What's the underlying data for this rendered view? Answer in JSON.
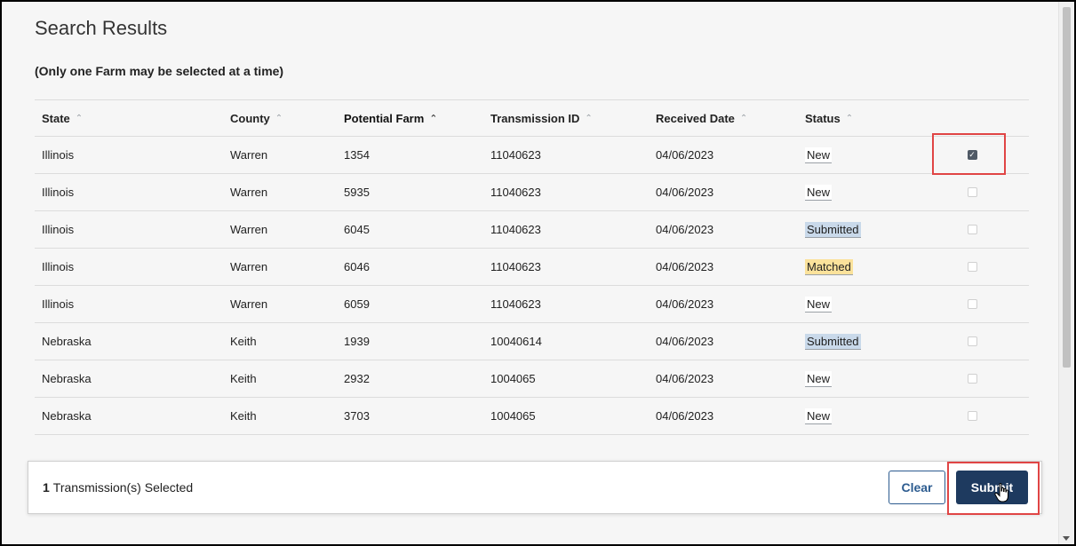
{
  "page": {
    "title": "Search Results",
    "note": "(Only one Farm may be selected at a time)"
  },
  "table": {
    "headers": {
      "state": "State",
      "county": "County",
      "potential_farm": "Potential Farm",
      "transmission_id": "Transmission ID",
      "received_date": "Received Date",
      "status": "Status"
    },
    "sort_icons": {
      "inactive": "⌃",
      "active": "⌃"
    },
    "rows": [
      {
        "state": "Illinois",
        "county": "Warren",
        "farm": "1354",
        "transmission_id": "11040623",
        "date": "04/06/2023",
        "status": "New",
        "checked": true
      },
      {
        "state": "Illinois",
        "county": "Warren",
        "farm": "5935",
        "transmission_id": "11040623",
        "date": "04/06/2023",
        "status": "New",
        "checked": false
      },
      {
        "state": "Illinois",
        "county": "Warren",
        "farm": "6045",
        "transmission_id": "11040623",
        "date": "04/06/2023",
        "status": "Submitted",
        "checked": false
      },
      {
        "state": "Illinois",
        "county": "Warren",
        "farm": "6046",
        "transmission_id": "11040623",
        "date": "04/06/2023",
        "status": "Matched",
        "checked": false
      },
      {
        "state": "Illinois",
        "county": "Warren",
        "farm": "6059",
        "transmission_id": "11040623",
        "date": "04/06/2023",
        "status": "New",
        "checked": false
      },
      {
        "state": "Nebraska",
        "county": "Keith",
        "farm": "1939",
        "transmission_id": "10040614",
        "date": "04/06/2023",
        "status": "Submitted",
        "checked": false
      },
      {
        "state": "Nebraska",
        "county": "Keith",
        "farm": "2932",
        "transmission_id": "1004065",
        "date": "04/06/2023",
        "status": "New",
        "checked": false
      },
      {
        "state": "Nebraska",
        "county": "Keith",
        "farm": "3703",
        "transmission_id": "1004065",
        "date": "04/06/2023",
        "status": "New",
        "checked": false
      }
    ]
  },
  "footer": {
    "selected_count": "1",
    "selected_label": "Transmission(s) Selected",
    "clear_label": "Clear",
    "submit_label": "Submit"
  },
  "colors": {
    "status_submitted": "#c9d9ea",
    "status_matched": "#fbe29b",
    "submit_button": "#1e3a5f",
    "highlight_box": "#e04545"
  },
  "icons": {
    "sort": "sort-ascending-icon",
    "checkbox": "checkbox-icon",
    "cursor": "hand-pointer-icon"
  }
}
